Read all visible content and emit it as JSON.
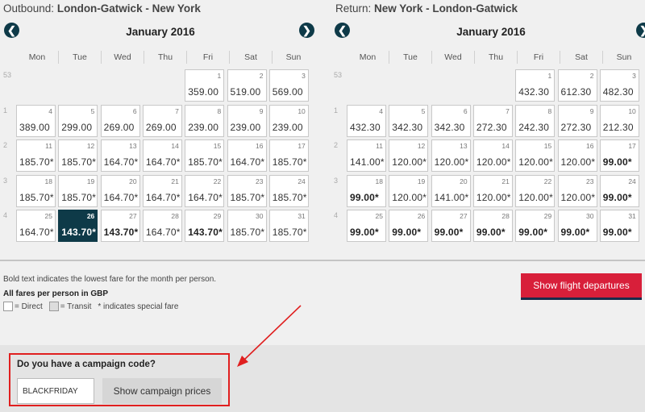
{
  "outbound": {
    "label": "Outbound:",
    "route": "London-Gatwick - New York",
    "month": "January 2016",
    "weeks": [
      {
        "num": "53",
        "days": [
          null,
          null,
          null,
          null,
          {
            "d": "1",
            "p": "359.00"
          },
          {
            "d": "2",
            "p": "519.00"
          },
          {
            "d": "3",
            "p": "569.00"
          }
        ]
      },
      {
        "num": "1",
        "days": [
          {
            "d": "4",
            "p": "389.00"
          },
          {
            "d": "5",
            "p": "299.00"
          },
          {
            "d": "6",
            "p": "269.00"
          },
          {
            "d": "7",
            "p": "269.00"
          },
          {
            "d": "8",
            "p": "239.00"
          },
          {
            "d": "9",
            "p": "239.00"
          },
          {
            "d": "10",
            "p": "239.00"
          }
        ]
      },
      {
        "num": "2",
        "days": [
          {
            "d": "11",
            "p": "185.70*"
          },
          {
            "d": "12",
            "p": "185.70*"
          },
          {
            "d": "13",
            "p": "164.70*"
          },
          {
            "d": "14",
            "p": "164.70*"
          },
          {
            "d": "15",
            "p": "185.70*"
          },
          {
            "d": "16",
            "p": "164.70*"
          },
          {
            "d": "17",
            "p": "185.70*"
          }
        ]
      },
      {
        "num": "3",
        "days": [
          {
            "d": "18",
            "p": "185.70*"
          },
          {
            "d": "19",
            "p": "185.70*"
          },
          {
            "d": "20",
            "p": "164.70*"
          },
          {
            "d": "21",
            "p": "164.70*"
          },
          {
            "d": "22",
            "p": "164.70*"
          },
          {
            "d": "23",
            "p": "185.70*"
          },
          {
            "d": "24",
            "p": "185.70*"
          }
        ]
      },
      {
        "num": "4",
        "days": [
          {
            "d": "25",
            "p": "164.70*"
          },
          {
            "d": "26",
            "p": "143.70*",
            "sel": true
          },
          {
            "d": "27",
            "p": "143.70*",
            "bold": true
          },
          {
            "d": "28",
            "p": "164.70*"
          },
          {
            "d": "29",
            "p": "143.70*",
            "bold": true
          },
          {
            "d": "30",
            "p": "185.70*"
          },
          {
            "d": "31",
            "p": "185.70*"
          }
        ]
      }
    ]
  },
  "return": {
    "label": "Return:",
    "route": "New York - London-Gatwick",
    "month": "January 2016",
    "weeks": [
      {
        "num": "53",
        "days": [
          null,
          null,
          null,
          null,
          {
            "d": "1",
            "p": "432.30"
          },
          {
            "d": "2",
            "p": "612.30"
          },
          {
            "d": "3",
            "p": "482.30"
          }
        ]
      },
      {
        "num": "1",
        "days": [
          {
            "d": "4",
            "p": "432.30"
          },
          {
            "d": "5",
            "p": "342.30"
          },
          {
            "d": "6",
            "p": "342.30"
          },
          {
            "d": "7",
            "p": "272.30"
          },
          {
            "d": "8",
            "p": "242.30"
          },
          {
            "d": "9",
            "p": "272.30"
          },
          {
            "d": "10",
            "p": "212.30"
          }
        ]
      },
      {
        "num": "2",
        "days": [
          {
            "d": "11",
            "p": "141.00*"
          },
          {
            "d": "12",
            "p": "120.00*"
          },
          {
            "d": "13",
            "p": "120.00*"
          },
          {
            "d": "14",
            "p": "120.00*"
          },
          {
            "d": "15",
            "p": "120.00*"
          },
          {
            "d": "16",
            "p": "120.00*"
          },
          {
            "d": "17",
            "p": "99.00*",
            "bold": true
          }
        ]
      },
      {
        "num": "3",
        "days": [
          {
            "d": "18",
            "p": "99.00*",
            "bold": true
          },
          {
            "d": "19",
            "p": "120.00*"
          },
          {
            "d": "20",
            "p": "141.00*"
          },
          {
            "d": "21",
            "p": "120.00*"
          },
          {
            "d": "22",
            "p": "120.00*"
          },
          {
            "d": "23",
            "p": "120.00*"
          },
          {
            "d": "24",
            "p": "99.00*",
            "bold": true
          }
        ]
      },
      {
        "num": "4",
        "days": [
          {
            "d": "25",
            "p": "99.00*",
            "bold": true
          },
          {
            "d": "26",
            "p": "99.00*",
            "bold": true
          },
          {
            "d": "27",
            "p": "99.00*",
            "bold": true
          },
          {
            "d": "28",
            "p": "99.00*",
            "bold": true
          },
          {
            "d": "29",
            "p": "99.00*",
            "bold": true
          },
          {
            "d": "30",
            "p": "99.00*",
            "bold": true
          },
          {
            "d": "31",
            "p": "99.00*",
            "bold": true
          }
        ]
      }
    ]
  },
  "days_of_week": [
    "Mon",
    "Tue",
    "Wed",
    "Thu",
    "Fri",
    "Sat",
    "Sun"
  ],
  "nav": {
    "prev_icon": "chevron-left-icon",
    "next_icon": "chevron-right-icon"
  },
  "legend": {
    "bold_note": "Bold text indicates the lowest fare for the month per person.",
    "currency_note": "All fares per person in GBP",
    "direct": "= Direct",
    "transit": "= Transit",
    "special": "* indicates special fare"
  },
  "show_departures_label": "Show flight departures",
  "campaign": {
    "title": "Do you have a campaign code?",
    "code_value": "BLACKFRIDAY",
    "button_label": "Show campaign prices"
  },
  "colors": {
    "accent": "#0e3a48",
    "primary_button": "#d81f3a",
    "annotation": "#e01f1f"
  }
}
